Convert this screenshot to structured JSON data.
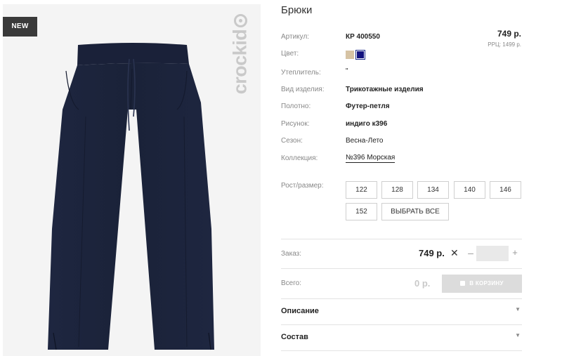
{
  "badge": {
    "label": "NEW"
  },
  "brand": {
    "watermark": "crockid"
  },
  "product": {
    "title": "Брюки",
    "price": "749 р.",
    "rrp": "РРЦ: 1499 р."
  },
  "attributes": [
    {
      "label": "Артикул:",
      "value": "КР 400550"
    },
    {
      "label": "Цвет:",
      "value": ""
    },
    {
      "label": "Утеплитель:",
      "value": "\""
    },
    {
      "label": "Вид изделия:",
      "value": "Трикотажные изделия"
    },
    {
      "label": "Полотно:",
      "value": "Футер-петля"
    },
    {
      "label": "Рисунок:",
      "value": "индиго к396"
    },
    {
      "label": "Сезон:",
      "value": "Весна-Лето"
    },
    {
      "label": "Коллекция:",
      "value": "№396 Морская"
    }
  ],
  "colors": [
    {
      "name": "beige",
      "hex": "#d6c3a4"
    },
    {
      "name": "indigo",
      "hex": "#12127e",
      "selected": true
    }
  ],
  "sizes": {
    "label": "Рост/размер:",
    "options": [
      "122",
      "128",
      "134",
      "140",
      "146",
      "152"
    ],
    "select_all": "ВЫБРАТЬ ВСЕ"
  },
  "order": {
    "label": "Заказ:",
    "price": "749 р.",
    "times": "✕",
    "minus": "–",
    "plus": "+",
    "quantity": ""
  },
  "total": {
    "label": "Всего:",
    "value": "0 р.",
    "cart_button": "В КОРЗИНУ"
  },
  "sections": [
    {
      "title": "Описание",
      "arrow": "▼"
    },
    {
      "title": "Состав",
      "arrow": "▼"
    }
  ],
  "theme": {
    "accent_disabled": "#dcdcdc",
    "product_color": "#1b2440"
  }
}
